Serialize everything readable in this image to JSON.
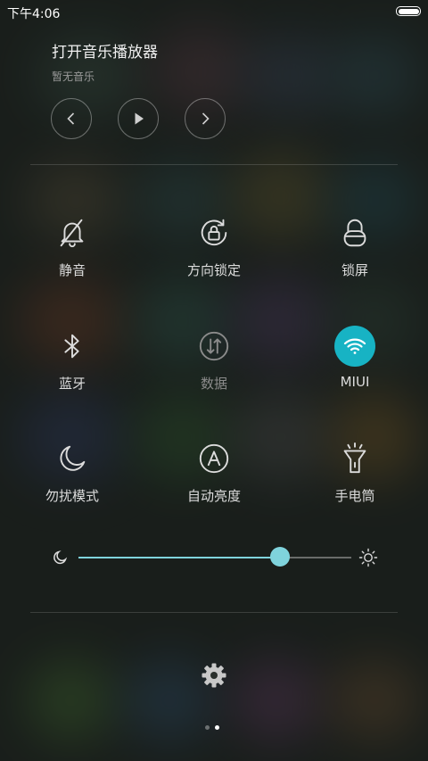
{
  "status_bar": {
    "time": "下午4:06",
    "battery_icon": "battery-full-icon"
  },
  "music": {
    "title": "打开音乐播放器",
    "subtitle": "暂无音乐",
    "controls": [
      "previous-icon",
      "play-icon",
      "next-icon"
    ]
  },
  "toggles": [
    {
      "label": "静音",
      "icon": "bell-off-icon",
      "state": "off"
    },
    {
      "label": "方向锁定",
      "icon": "rotation-lock-icon",
      "state": "off"
    },
    {
      "label": "锁屏",
      "icon": "lock-icon",
      "state": "off"
    },
    {
      "label": "蓝牙",
      "icon": "bluetooth-icon",
      "state": "off"
    },
    {
      "label": "数据",
      "icon": "mobile-data-icon",
      "state": "disabled"
    },
    {
      "label": "MIUI",
      "icon": "wifi-icon",
      "state": "on"
    },
    {
      "label": "勿扰模式",
      "icon": "moon-icon",
      "state": "off"
    },
    {
      "label": "自动亮度",
      "icon": "auto-brightness-icon",
      "state": "off"
    },
    {
      "label": "手电筒",
      "icon": "flashlight-icon",
      "state": "off"
    }
  ],
  "brightness": {
    "level": 0.74
  },
  "pager": {
    "pages": 2,
    "current": 2
  },
  "colors": {
    "accent": "#17b3c4",
    "slider": "#7fd3dc"
  }
}
